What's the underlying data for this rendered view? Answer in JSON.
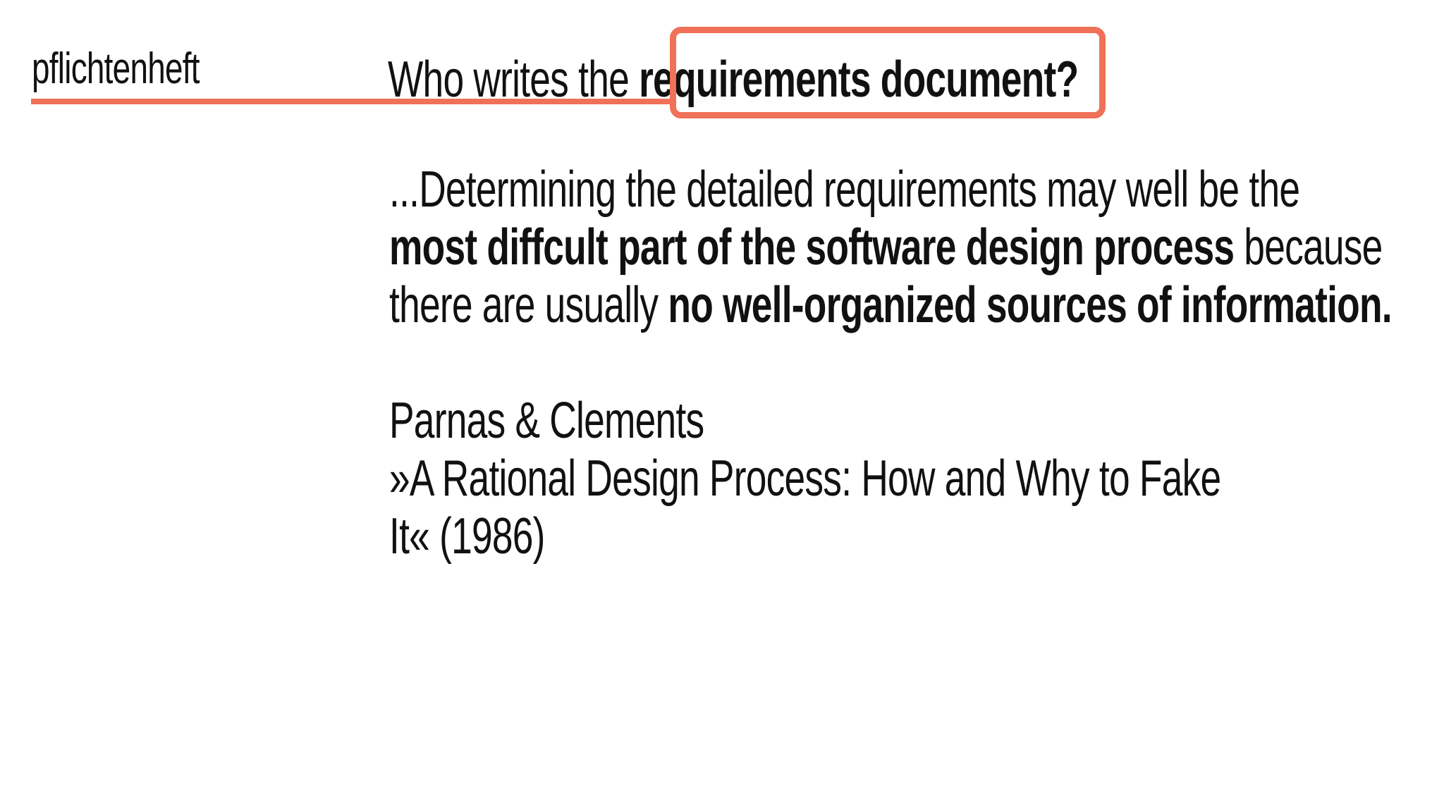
{
  "topic": "pflichtenheft",
  "title": {
    "normal": "Who writes the ",
    "highlight": "requirements document?"
  },
  "quote": {
    "line1": "...Determining the detailed requirements may well be the",
    "line2_bold": "most diffcult part of the software design process",
    "line2_normal": " because",
    "line3_normal": "there are usually ",
    "line3_bold": "no well-organized sources of information."
  },
  "citation": {
    "authors": "Parnas & Clements",
    "work_line1": "»A Rational Design Process: How and Why to Fake",
    "work_line2": "It« (1986)"
  },
  "colors": {
    "accent": "#f07058",
    "text": "#111111",
    "background": "#ffffff"
  }
}
